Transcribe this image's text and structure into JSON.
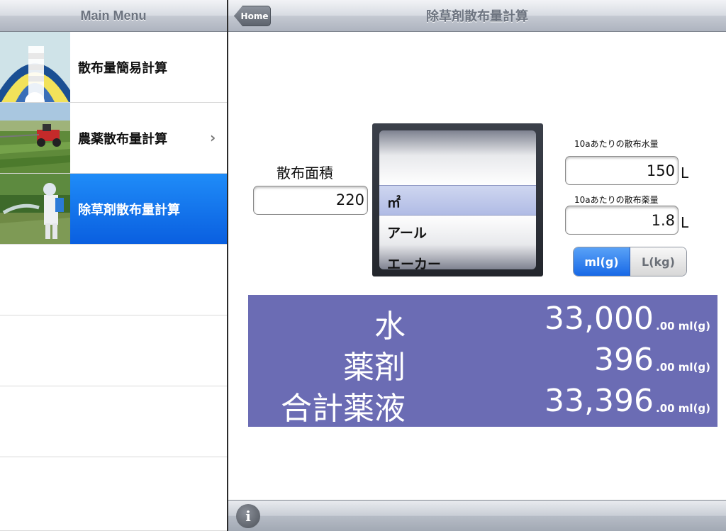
{
  "sidebar": {
    "title": "Main Menu",
    "items": [
      {
        "label": "散布量簡易計算",
        "selected": false
      },
      {
        "label": "農薬散布量計算",
        "selected": false,
        "has_chevron": true
      },
      {
        "label": "除草剤散布量計算",
        "selected": true
      },
      {
        "label": ""
      },
      {
        "label": ""
      },
      {
        "label": ""
      },
      {
        "label": ""
      }
    ]
  },
  "header": {
    "title": "除草剤散布量計算",
    "home_label": "Home"
  },
  "form": {
    "area_label": "散布面積",
    "area_value": "220",
    "picker_options": [
      "㎡",
      "アール",
      "エーカー"
    ],
    "picker_selected": "㎡",
    "water_label": "10aあたりの散布水量",
    "water_value": "150",
    "water_unit": "L",
    "chem_label": "10aあたりの散布薬量",
    "chem_value": "1.8",
    "chem_unit": "L",
    "unit_toggle": [
      "ml(g)",
      "L(kg)"
    ],
    "unit_selected": "ml(g)"
  },
  "results": [
    {
      "label": "水",
      "value": "33,000",
      "decimal": ".00 ml(g)"
    },
    {
      "label": "薬剤",
      "value": "396",
      "decimal": ".00 ml(g)"
    },
    {
      "label": "合計薬液",
      "value": "33,396",
      "decimal": ".00 ml(g)"
    }
  ],
  "toolbar": {
    "info_label": "i"
  },
  "colors": {
    "accent": "#0a5fe0",
    "results_bg": "#6b6cb4"
  }
}
